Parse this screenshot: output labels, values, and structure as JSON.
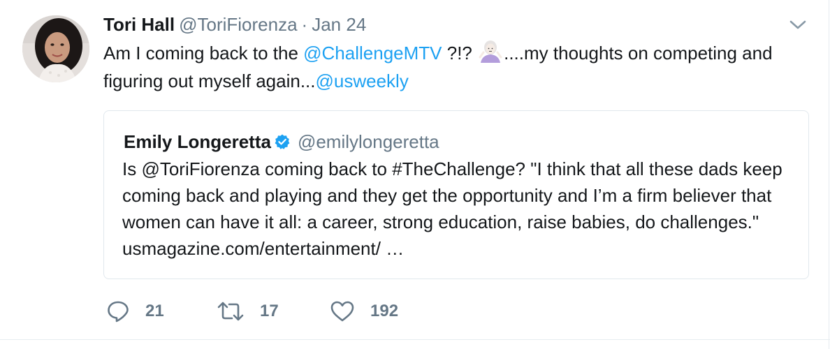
{
  "tweet": {
    "author_name": "Tori Hall",
    "author_handle": "@ToriFiorenza",
    "separator": "·",
    "date": "Jan 24",
    "text": {
      "part1": "Am I coming back to the ",
      "mention1": "@ChallengeMTV",
      "part2": " ?!? ",
      "emoji": "woman-shrugging-emoji",
      "part3": "....my thoughts on competing and figuring out myself again...",
      "mention2": "@usweekly"
    },
    "menu_icon": "chevron-down-icon"
  },
  "quoted_tweet": {
    "author_name": "Emily Longeretta",
    "verified_icon": "verified-badge-icon",
    "author_handle": "@emilylongeretta",
    "text": "Is @ToriFiorenza coming back to #TheChallenge? \"I think that all these dads keep coming back and playing and they get the opportunity and I’m a firm believer that women can have it all: a career, strong education, raise babies, do challenges.\" usmagazine.com/entertainment/  …"
  },
  "actions": {
    "reply": {
      "icon": "reply-icon",
      "count": "21"
    },
    "retweet": {
      "icon": "retweet-icon",
      "count": "17"
    },
    "like": {
      "icon": "heart-icon",
      "count": "192"
    }
  },
  "colors": {
    "link": "#1da1f2",
    "secondary_text": "#657786",
    "primary_text": "#14171a",
    "verified": "#1da1f2",
    "border": "#e1e8ed"
  }
}
